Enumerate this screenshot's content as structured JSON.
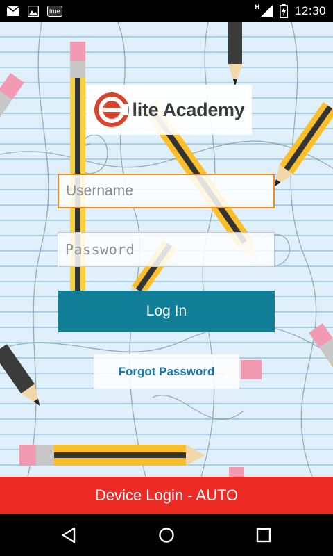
{
  "status_bar": {
    "badge": "true",
    "time": "12:30",
    "network_letter": "H",
    "icons": [
      "mail-icon",
      "image-icon",
      "signal-icon",
      "battery-charging-icon"
    ]
  },
  "logo": {
    "text": "lite Academy",
    "mark": "E-circle-logo",
    "brand_color": "#d9452c"
  },
  "login_form": {
    "username_placeholder": "Username",
    "password_placeholder": "Password",
    "login_label": "Log In",
    "forgot_label": "Forgot Password"
  },
  "device_login": {
    "label": "Device Login - AUTO"
  },
  "colors": {
    "accent": "#117f98",
    "focus_border": "#f28a1f",
    "device_bar": "#ee2a24",
    "link": "#1879a6"
  },
  "nav_bar": {
    "icons": [
      "back-icon",
      "home-icon",
      "recents-icon"
    ]
  }
}
